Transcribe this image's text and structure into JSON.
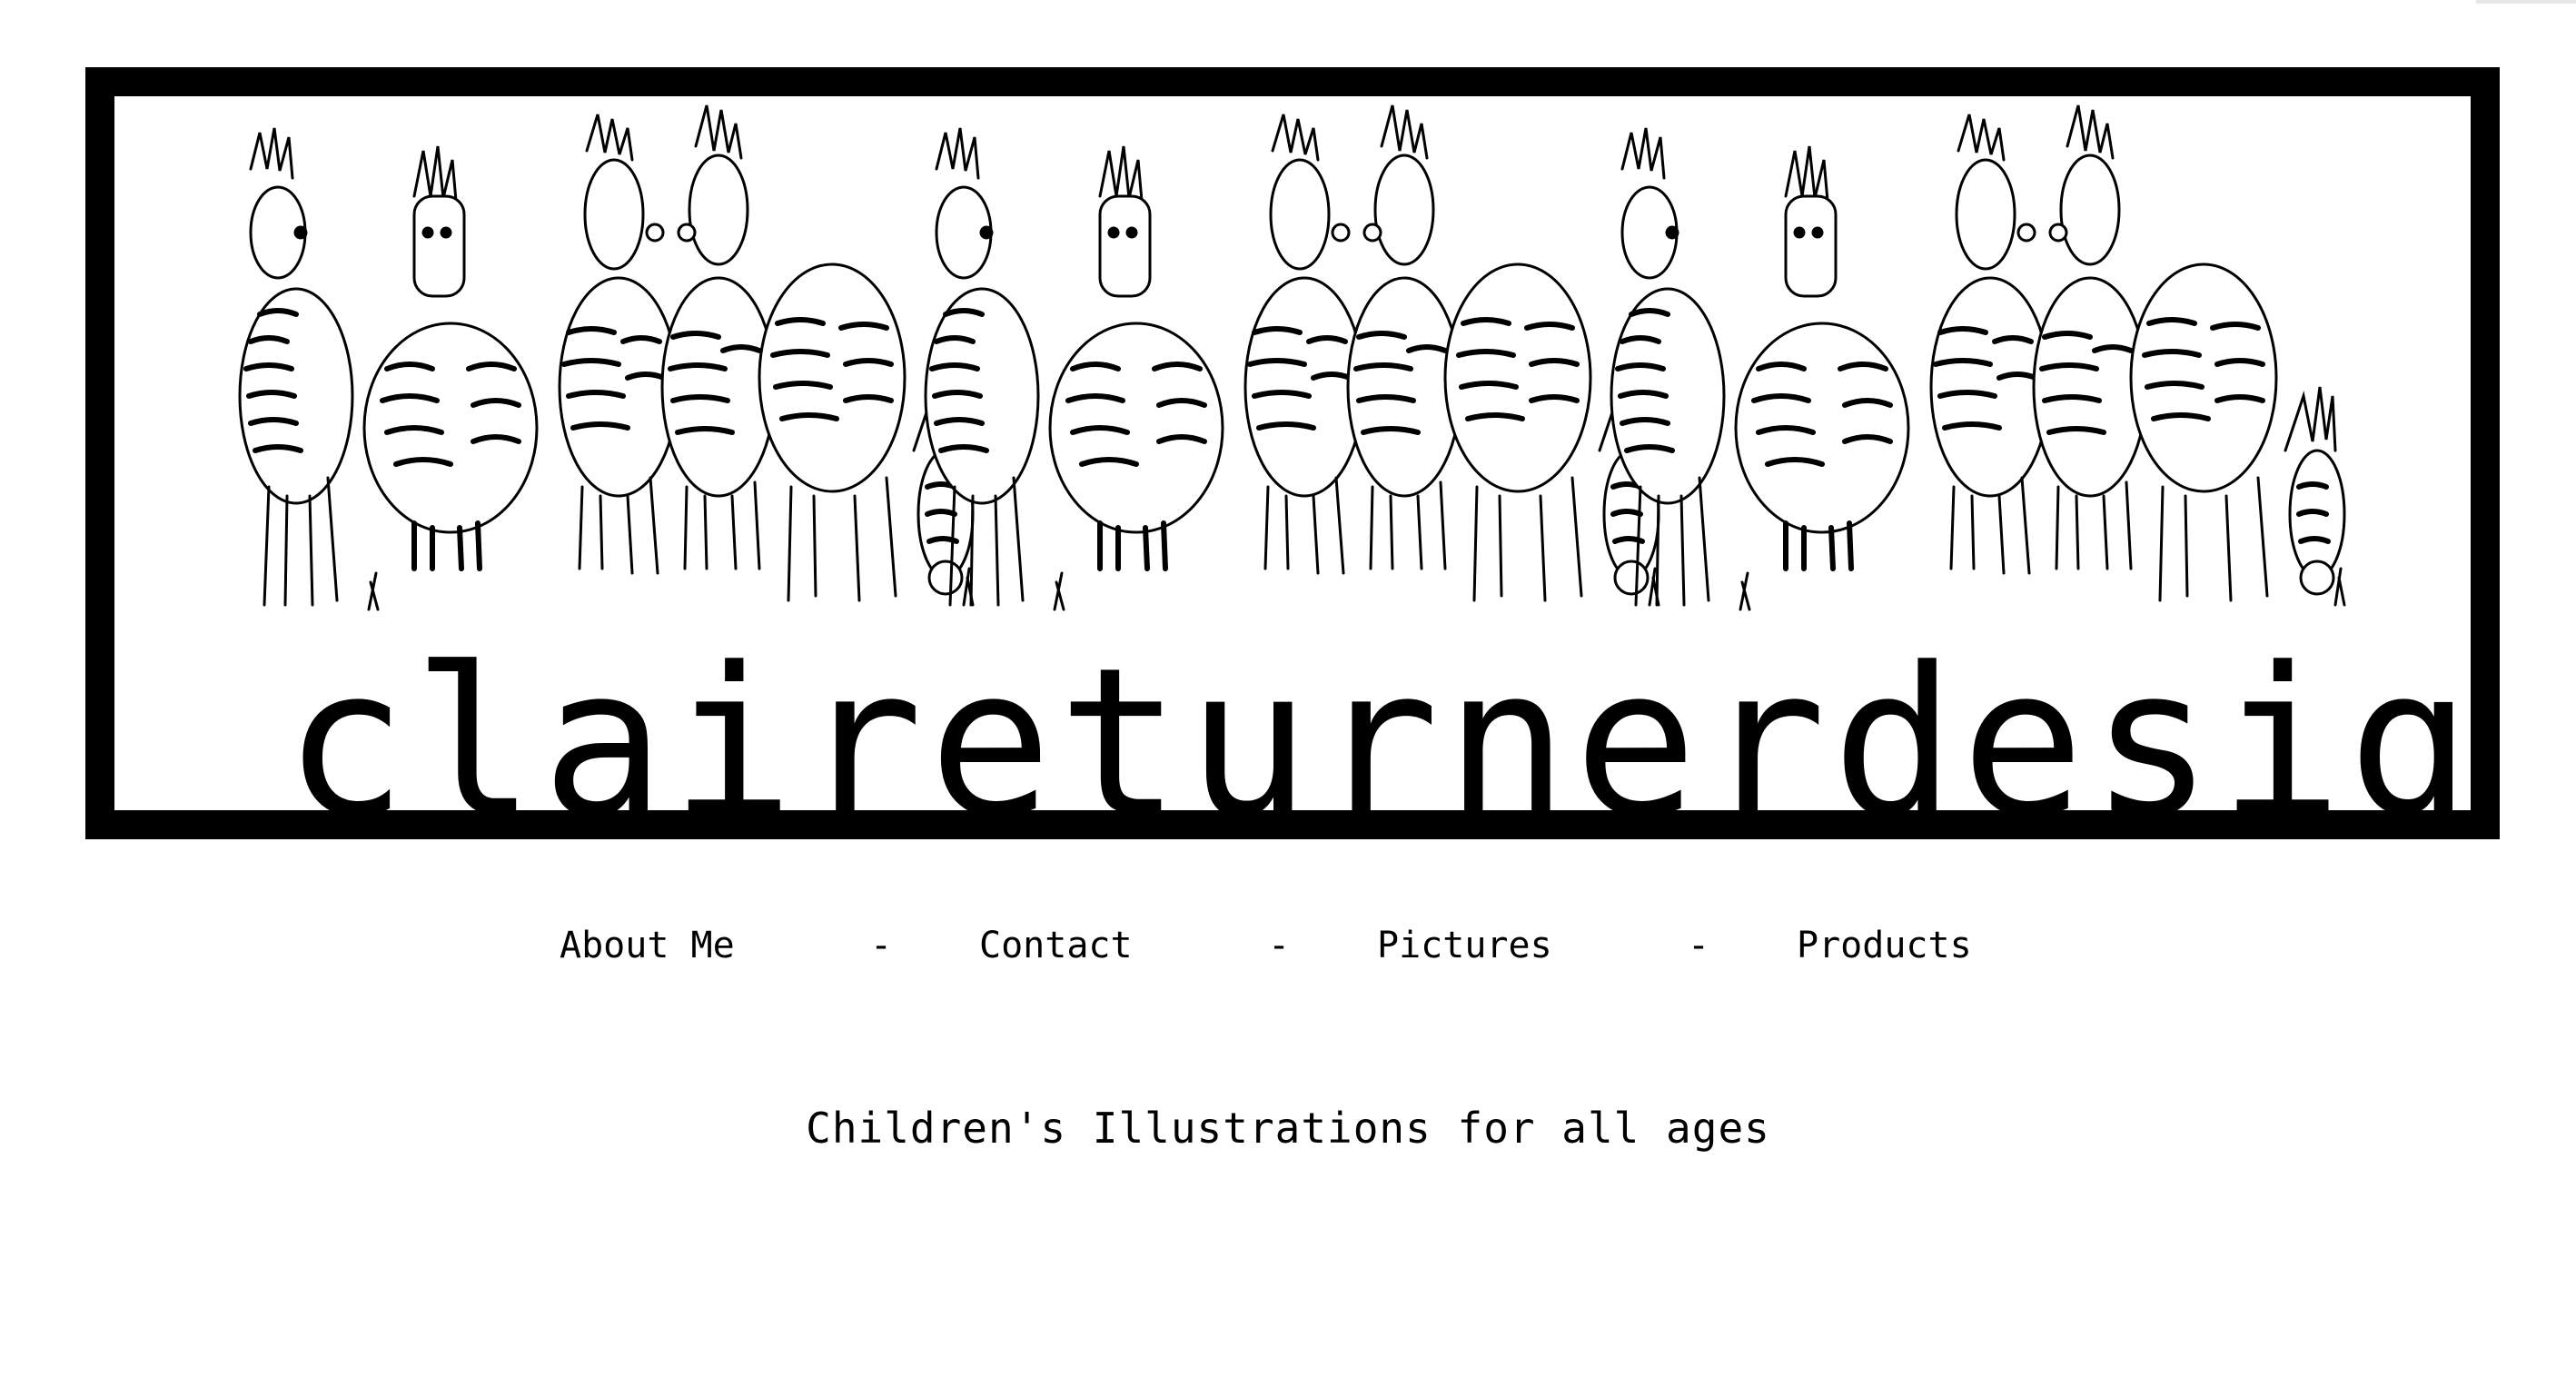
{
  "banner": {
    "wordmark": "claireturnerdesign",
    "illustration": "zebra-herd-drawing",
    "frame_color": "#000000"
  },
  "nav": {
    "items": [
      {
        "label": "About Me"
      },
      {
        "label": "Contact"
      },
      {
        "label": "Pictures"
      },
      {
        "label": "Products"
      }
    ],
    "separator": "-"
  },
  "tagline": "Children's Illustrations for all ages"
}
